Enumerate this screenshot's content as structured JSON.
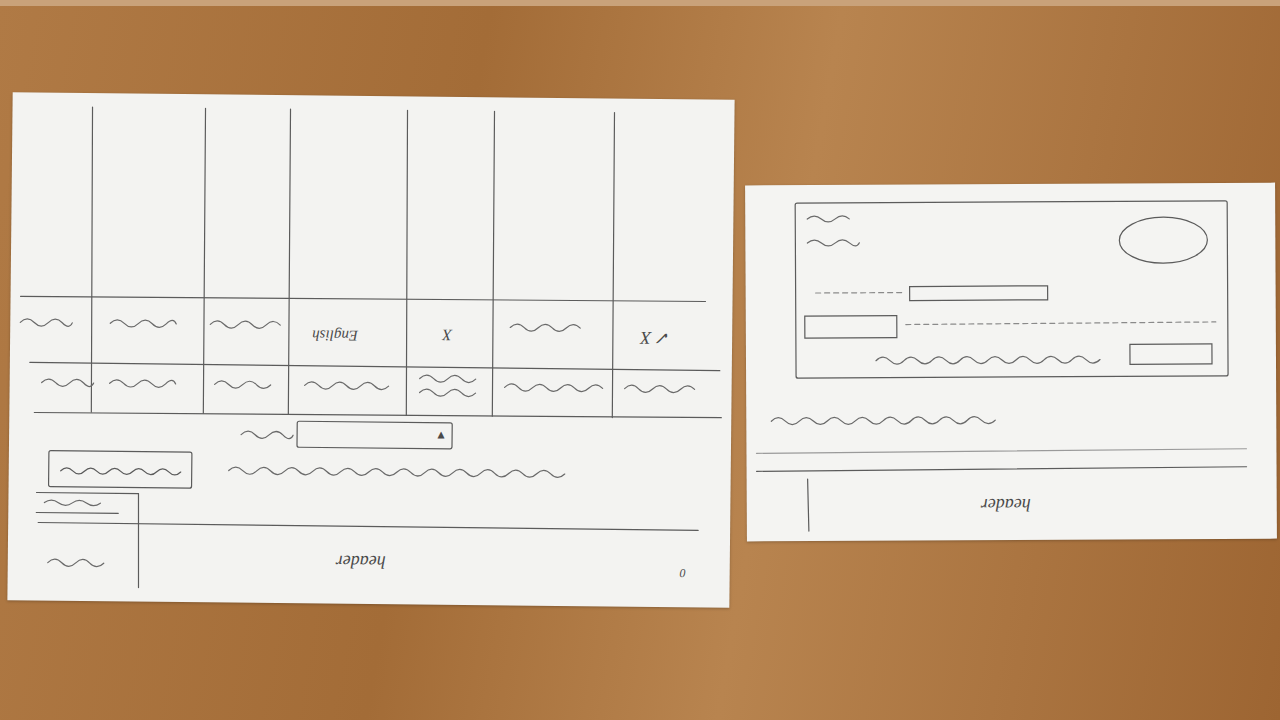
{
  "sheets": [
    {
      "header": "header",
      "columns": [
        "✓ X",
        "X",
        "English"
      ],
      "dropdown_arrow": "▼",
      "page_mark": "0"
    },
    {
      "header": "header"
    }
  ]
}
